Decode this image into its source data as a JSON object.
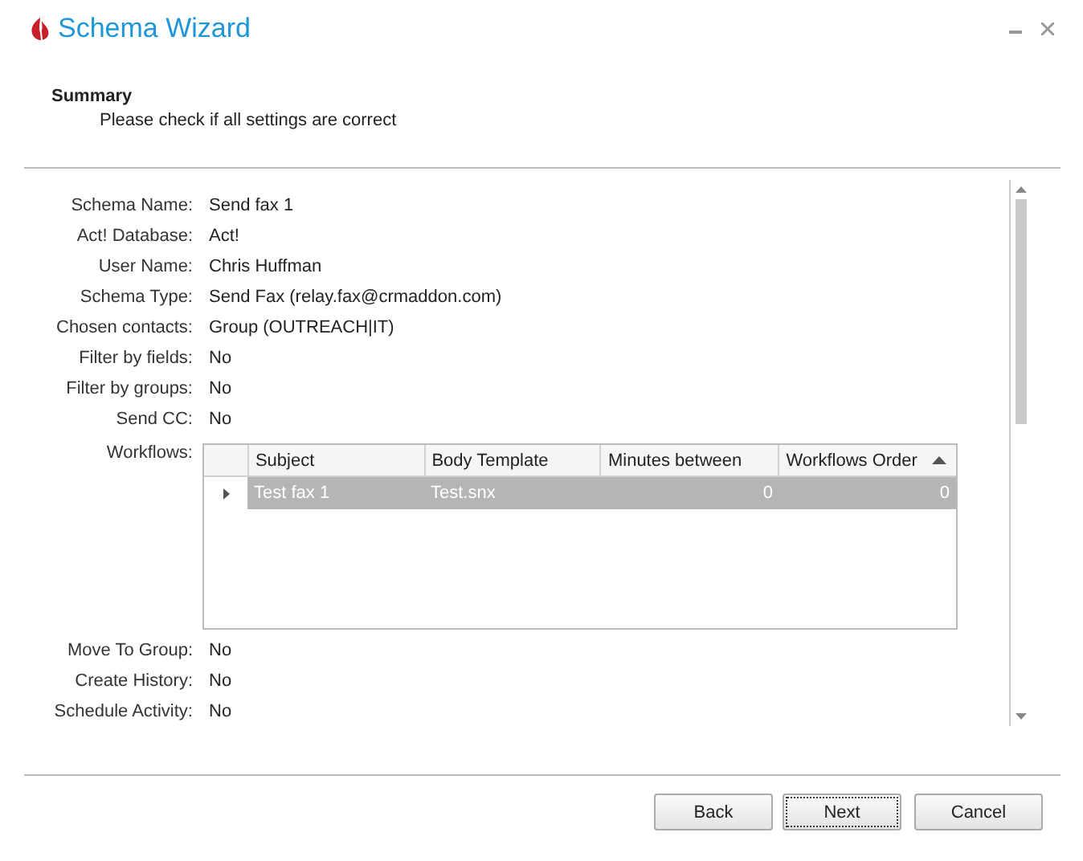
{
  "window": {
    "title": "Schema Wizard"
  },
  "header": {
    "title": "Summary",
    "subtitle": "Please check if all settings are correct"
  },
  "fields_before": [
    {
      "label": "Schema Name:",
      "value": "Send fax 1"
    },
    {
      "label": "Act! Database:",
      "value": "Act!"
    },
    {
      "label": "User Name:",
      "value": "Chris Huffman"
    },
    {
      "label": "Schema Type:",
      "value": "Send Fax (relay.fax@crmaddon.com)"
    },
    {
      "label": "Chosen contacts:",
      "value": "Group (OUTREACH|IT)"
    },
    {
      "label": "Filter by fields:",
      "value": "No"
    },
    {
      "label": "Filter by groups:",
      "value": "No"
    },
    {
      "label": "Send CC:",
      "value": "No"
    }
  ],
  "workflows": {
    "label": "Workflows:",
    "columns": [
      {
        "label": "Subject",
        "sorted": false
      },
      {
        "label": "Body Template",
        "sorted": false
      },
      {
        "label": "Minutes between",
        "sorted": false
      },
      {
        "label": "Workflows Order",
        "sorted": true
      }
    ],
    "rows": [
      {
        "selected": true,
        "cells": [
          "Test fax 1",
          "Test.snx",
          "0",
          "0"
        ]
      }
    ]
  },
  "fields_after": [
    {
      "label": "Move To Group:",
      "value": "No"
    },
    {
      "label": "Create History:",
      "value": "No"
    },
    {
      "label": "Schedule Activity:",
      "value": "No"
    }
  ],
  "buttons": [
    {
      "label": "Back",
      "focused": false
    },
    {
      "label": "Next",
      "focused": true
    },
    {
      "label": "Cancel",
      "focused": false
    }
  ]
}
